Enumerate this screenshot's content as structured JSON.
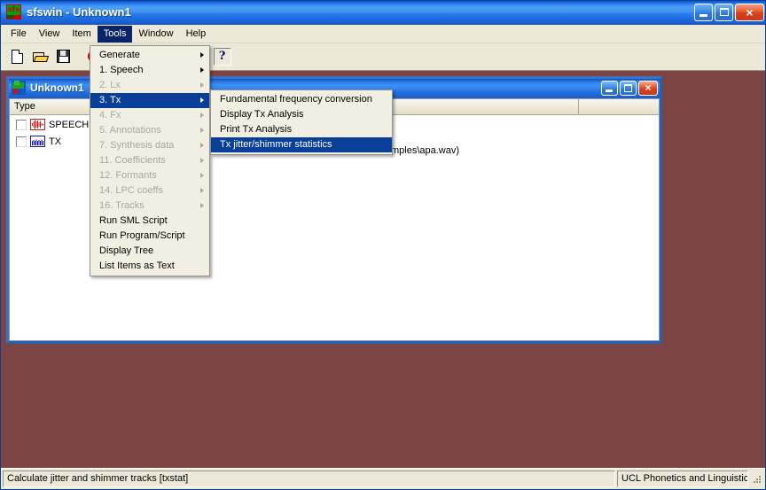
{
  "window": {
    "title": "sfswin - Unknown1",
    "app_icon": "sfs-icon",
    "buttons": {
      "minimize": "minimize-button",
      "maximize": "maximize-button",
      "close": "×"
    }
  },
  "menubar": {
    "items": [
      {
        "label": "File",
        "active": false
      },
      {
        "label": "View",
        "active": false
      },
      {
        "label": "Item",
        "active": false
      },
      {
        "label": "Tools",
        "active": true
      },
      {
        "label": "Window",
        "active": false
      },
      {
        "label": "Help",
        "active": false
      }
    ]
  },
  "toolbar": {
    "buttons": [
      {
        "name": "new-document-button",
        "icon": "new-document-icon"
      },
      {
        "name": "open-file-button",
        "icon": "open-folder-icon"
      },
      {
        "name": "save-file-button",
        "icon": "save-disk-icon"
      },
      {
        "name": "record-button",
        "icon": "record-circle-icon"
      },
      {
        "name": "help-button",
        "icon": "question-mark-icon",
        "glyph": "?"
      }
    ]
  },
  "tools_menu": {
    "items": [
      {
        "label": "Generate",
        "disabled": false,
        "submenu": true,
        "selected": false
      },
      {
        "label": "1. Speech",
        "disabled": false,
        "submenu": true,
        "selected": false
      },
      {
        "label": "2. Lx",
        "disabled": true,
        "submenu": true,
        "selected": false
      },
      {
        "label": "3. Tx",
        "disabled": false,
        "submenu": true,
        "selected": true
      },
      {
        "label": "4. Fx",
        "disabled": true,
        "submenu": true,
        "selected": false
      },
      {
        "label": "5. Annotations",
        "disabled": true,
        "submenu": true,
        "selected": false
      },
      {
        "label": "7. Synthesis data",
        "disabled": true,
        "submenu": true,
        "selected": false
      },
      {
        "label": "11. Coefficients",
        "disabled": true,
        "submenu": true,
        "selected": false
      },
      {
        "label": "12. Formants",
        "disabled": true,
        "submenu": true,
        "selected": false
      },
      {
        "label": "14. LPC coeffs",
        "disabled": true,
        "submenu": true,
        "selected": false
      },
      {
        "label": "16. Tracks",
        "disabled": true,
        "submenu": true,
        "selected": false
      },
      {
        "label": "Run SML Script",
        "disabled": false,
        "submenu": false,
        "selected": false
      },
      {
        "label": "Run Program/Script",
        "disabled": false,
        "submenu": false,
        "selected": false
      },
      {
        "label": "Display Tree",
        "disabled": false,
        "submenu": false,
        "selected": false
      },
      {
        "label": "List Items as Text",
        "disabled": false,
        "submenu": false,
        "selected": false
      }
    ]
  },
  "tx_submenu": {
    "items": [
      {
        "label": "Fundamental frequency conversion",
        "selected": false
      },
      {
        "label": "Display Tx Analysis",
        "selected": false
      },
      {
        "label": "Print Tx Analysis",
        "selected": false
      },
      {
        "label": "Tx jitter/shimmer statistics",
        "selected": true
      }
    ]
  },
  "child_window": {
    "title": "Unknown1",
    "icon": "tree-document-icon",
    "buttons": {
      "minimize": "minimize-button",
      "maximize": "maximize-button",
      "close": "×"
    },
    "list": {
      "columns": [
        "Type",
        "",
        ""
      ],
      "rows": [
        {
          "checked": false,
          "icon": "speech-waveform-icon",
          "type": "SPEECH"
        },
        {
          "checked": false,
          "icon": "tx-track-icon",
          "type": "TX"
        }
      ],
      "partial_text": "mples\\apa.wav)"
    }
  },
  "statusbar": {
    "message": "Calculate jitter and shimmer tracks [txstat]",
    "right": "UCL Phonetics and Linguistics"
  },
  "colors": {
    "titlebar_blue": "#2f84f0",
    "menu_highlight": "#0a3f99",
    "mdi_background": "#7c4443",
    "chrome": "#ece9d8"
  }
}
